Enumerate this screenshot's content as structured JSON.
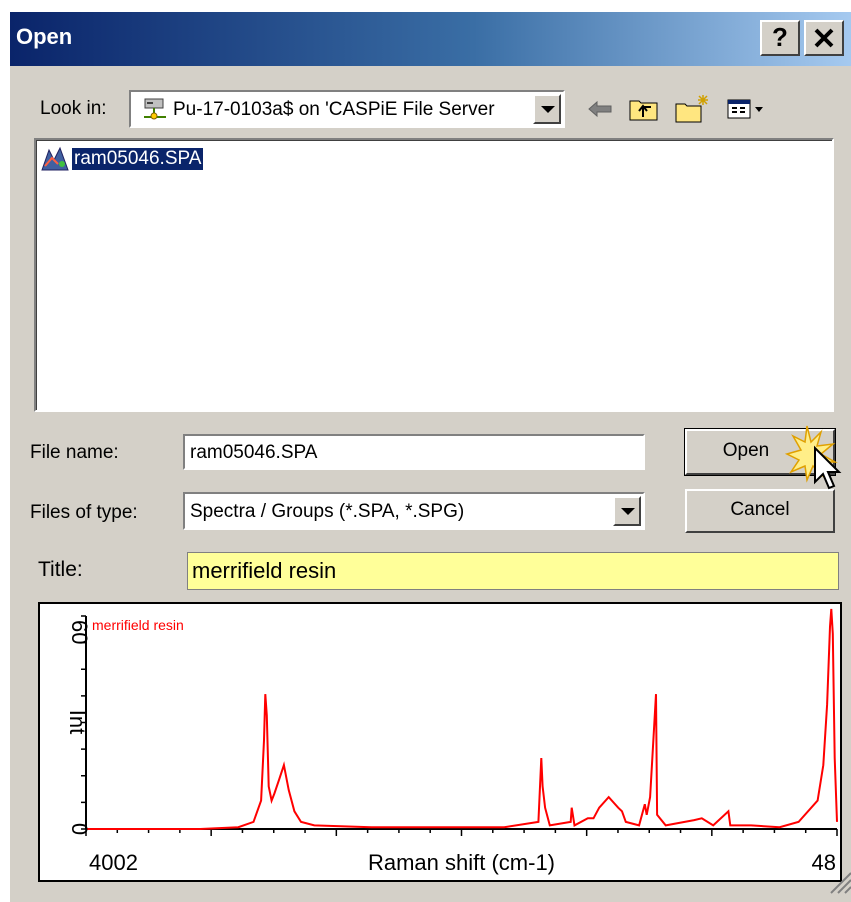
{
  "dialog": {
    "title": "Open",
    "help_label": "?",
    "close_label": "✕"
  },
  "look_in": {
    "label": "Look in:",
    "value": "Pu-17-0103a$ on 'CASPiE File Server"
  },
  "file_list": {
    "items": [
      {
        "name": "ram05046.SPA",
        "selected": true
      }
    ]
  },
  "file_name": {
    "label": "File name:",
    "value": "ram05046.SPA"
  },
  "file_type": {
    "label": "Files of type:",
    "value": "Spectra / Groups (*.SPA, *.SPG)"
  },
  "buttons": {
    "open": "Open",
    "cancel": "Cancel"
  },
  "title_field": {
    "label": "Title:",
    "value": "merrifield resin",
    "background": "#ffff99"
  },
  "icons": [
    "network-drive-icon",
    "back-arrow-icon",
    "up-folder-icon",
    "new-folder-icon",
    "view-menu-icon",
    "spectrum-file-icon",
    "cursor-icon",
    "resize-grip-icon"
  ],
  "chart_data": {
    "type": "line",
    "series": [
      {
        "name": "merrifield resin",
        "color": "#ff0000",
        "points": [
          [
            4002,
            0
          ],
          [
            3400,
            0
          ],
          [
            3200,
            0.5
          ],
          [
            3120,
            2
          ],
          [
            3080,
            8
          ],
          [
            3065,
            25
          ],
          [
            3058,
            38
          ],
          [
            3050,
            32
          ],
          [
            3040,
            12
          ],
          [
            3025,
            8
          ],
          [
            3010,
            10
          ],
          [
            2985,
            14
          ],
          [
            2960,
            18
          ],
          [
            2935,
            11
          ],
          [
            2905,
            5
          ],
          [
            2870,
            2
          ],
          [
            2800,
            1
          ],
          [
            2500,
            0.5
          ],
          [
            1800,
            0.5
          ],
          [
            1620,
            2
          ],
          [
            1605,
            20
          ],
          [
            1598,
            12
          ],
          [
            1585,
            6
          ],
          [
            1560,
            1
          ],
          [
            1450,
            2
          ],
          [
            1445,
            6
          ],
          [
            1430,
            1
          ],
          [
            1360,
            3
          ],
          [
            1330,
            3
          ],
          [
            1300,
            6
          ],
          [
            1250,
            9
          ],
          [
            1200,
            6
          ],
          [
            1180,
            5
          ],
          [
            1160,
            2
          ],
          [
            1090,
            1
          ],
          [
            1060,
            7
          ],
          [
            1050,
            4
          ],
          [
            1032,
            9
          ],
          [
            1001,
            38
          ],
          [
            995,
            4
          ],
          [
            950,
            1
          ],
          [
            850,
            2
          ],
          [
            800,
            2.5
          ],
          [
            760,
            3
          ],
          [
            700,
            1
          ],
          [
            620,
            5
          ],
          [
            610,
            1
          ],
          [
            500,
            1
          ],
          [
            350,
            0.5
          ],
          [
            250,
            2
          ],
          [
            150,
            8
          ],
          [
            120,
            18
          ],
          [
            100,
            35
          ],
          [
            85,
            57
          ],
          [
            78,
            62
          ],
          [
            70,
            55
          ],
          [
            60,
            20
          ],
          [
            48,
            2
          ]
        ]
      }
    ],
    "xlabel": "Raman shift (cm-1)",
    "ylabel": "Int",
    "xlim": [
      4002,
      48
    ],
    "ylim": [
      0,
      60
    ],
    "x_tick_labels": [
      "4002",
      "48"
    ],
    "y_tick_labels": [
      "0",
      "60"
    ],
    "legend": "top-left"
  }
}
